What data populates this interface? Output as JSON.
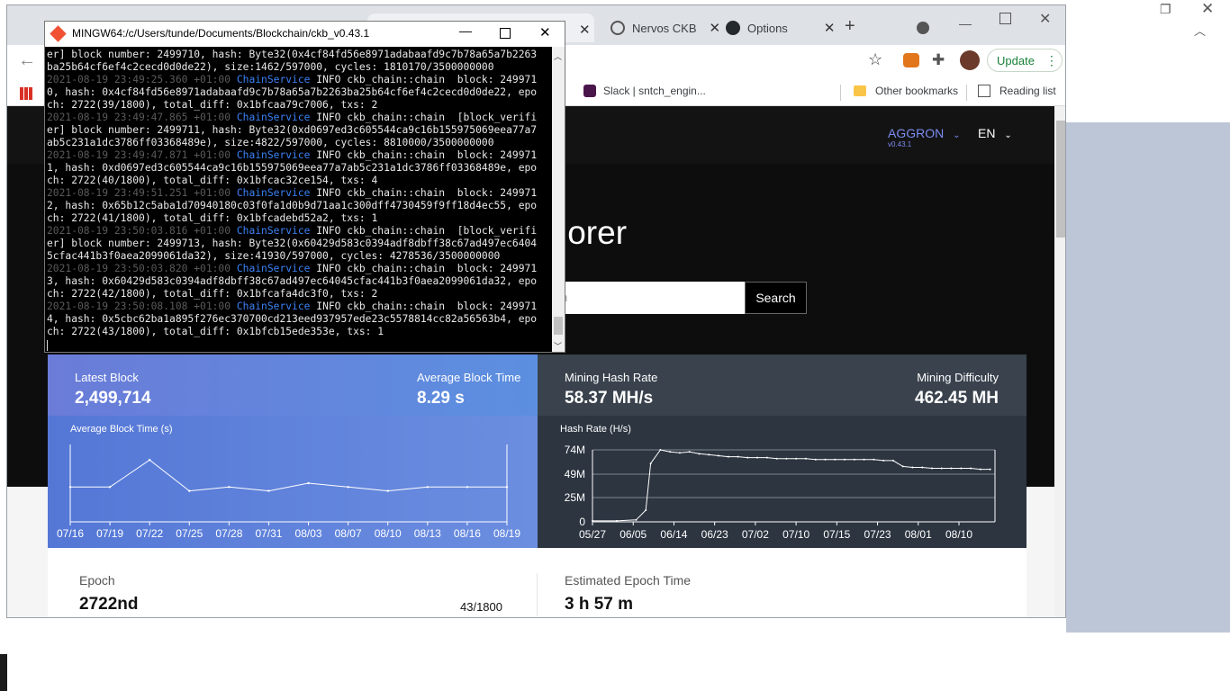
{
  "background_browser": {
    "tabs": [
      {
        "label": "Nervos CKB"
      },
      {
        "label": "Options"
      }
    ],
    "new_tab": "+"
  },
  "browser": {
    "tabs": [
      {
        "label": "Nervos CKB"
      },
      {
        "label": "Options"
      }
    ],
    "new_tab": "+",
    "update_label": "Update",
    "bookmarks": [
      {
        "label": "Slack | sntch_engin..."
      },
      {
        "label": "Other bookmarks"
      },
      {
        "label": "Reading list"
      }
    ]
  },
  "explorer": {
    "network": "AGGRON",
    "version": "v0.43.1",
    "language": "EN",
    "hero_title": "lorer",
    "search_placeholder": "h",
    "search_button": "Search",
    "stats": {
      "latest_block_label": "Latest Block",
      "latest_block": "2,499,714",
      "avg_block_time_label": "Average Block Time",
      "avg_block_time": "8.29 s",
      "hash_rate_label": "Mining Hash Rate",
      "hash_rate": "58.37 MH/s",
      "difficulty_label": "Mining Difficulty",
      "difficulty": "462.45 MH"
    },
    "epoch_label": "Epoch",
    "epoch": "2722nd",
    "epoch_progress": "43/1800",
    "estimated_epoch_label": "Estimated Epoch Time",
    "estimated_epoch": "3 h 57 m"
  },
  "chart_data": [
    {
      "type": "line",
      "title": "Average Block Time (s)",
      "categories": [
        "07/16",
        "07/19",
        "07/22",
        "07/25",
        "07/28",
        "07/31",
        "08/03",
        "08/07",
        "08/10",
        "08/13",
        "08/16",
        "08/19"
      ],
      "series": [
        {
          "values": [
            9,
            9,
            16,
            8,
            9,
            8,
            10,
            9,
            8,
            9,
            9,
            9
          ]
        }
      ],
      "grid": false
    },
    {
      "type": "line",
      "title": "Hash Rate (H/s)",
      "categories": [
        "05/27",
        "06/05",
        "06/14",
        "06/23",
        "07/02",
        "07/10",
        "07/15",
        "07/23",
        "08/01",
        "08/10"
      ],
      "yticks": [
        "0",
        "25M",
        "49M",
        "74M"
      ],
      "ylim": [
        0,
        74
      ],
      "x": [
        0,
        5,
        9,
        11,
        12,
        14,
        16,
        18,
        20,
        22,
        24,
        26,
        28,
        30,
        32,
        34,
        36,
        38,
        40,
        42,
        44,
        46,
        48,
        50,
        52,
        54,
        56,
        58,
        60,
        62,
        64,
        66,
        68,
        70,
        72,
        74,
        76,
        78,
        80,
        82
      ],
      "series": [
        {
          "values": [
            1,
            1,
            2,
            12,
            60,
            74,
            72,
            71,
            72,
            70,
            69,
            68,
            67,
            67,
            66,
            66,
            66,
            65,
            65,
            65,
            65,
            64,
            64,
            64,
            64,
            64,
            64,
            64,
            63,
            63,
            57,
            56,
            56,
            55,
            55,
            55,
            55,
            55,
            54,
            54
          ]
        }
      ],
      "grid": true
    }
  ],
  "terminal": {
    "title": "MINGW64:/c/Users/tunde/Documents/Blockchain/ckb_v0.43.1",
    "lines": [
      {
        "ts": "",
        "svc": "",
        "text": "er] block number: 2499710, hash: Byte32(0x4cf84fd56e8971adabaafd9c7b78a65a7b2263"
      },
      {
        "ts": "",
        "svc": "",
        "text": "ba25b64cf6ef4c2cecd0d0de22), size:1462/597000, cycles: 1810170/3500000000"
      },
      {
        "ts": "2021-08-19 23:49:25.360 +01:00 ",
        "svc": "ChainService",
        "text": " INFO ckb_chain::chain  block: 249971"
      },
      {
        "ts": "",
        "svc": "",
        "text": "0, hash: 0x4cf84fd56e8971adabaafd9c7b78a65a7b2263ba25b64cf6ef4c2cecd0d0de22, epo"
      },
      {
        "ts": "",
        "svc": "",
        "text": "ch: 2722(39/1800), total_diff: 0x1bfcaa79c7006, txs: 2"
      },
      {
        "ts": "2021-08-19 23:49:47.865 +01:00 ",
        "svc": "ChainService",
        "text": " INFO ckb_chain::chain  [block_verifi"
      },
      {
        "ts": "",
        "svc": "",
        "text": "er] block number: 2499711, hash: Byte32(0xd0697ed3c605544ca9c16b155975069eea77a7"
      },
      {
        "ts": "",
        "svc": "",
        "text": "ab5c231a1dc3786ff03368489e), size:4822/597000, cycles: 8810000/3500000000"
      },
      {
        "ts": "2021-08-19 23:49:47.871 +01:00 ",
        "svc": "ChainService",
        "text": " INFO ckb_chain::chain  block: 249971"
      },
      {
        "ts": "",
        "svc": "",
        "text": "1, hash: 0xd0697ed3c605544ca9c16b155975069eea77a7ab5c231a1dc3786ff03368489e, epo"
      },
      {
        "ts": "",
        "svc": "",
        "text": "ch: 2722(40/1800), total_diff: 0x1bfcac32ce154, txs: 4"
      },
      {
        "ts": "2021-08-19 23:49:51.251 +01:00 ",
        "svc": "ChainService",
        "text": " INFO ckb_chain::chain  block: 249971"
      },
      {
        "ts": "",
        "svc": "",
        "text": "2, hash: 0x65b12c5aba1d70940180c03f0fa1d0b9d71aa1c300dff4730459f9ff18d4ec55, epo"
      },
      {
        "ts": "",
        "svc": "",
        "text": "ch: 2722(41/1800), total_diff: 0x1bfcadebd52a2, txs: 1"
      },
      {
        "ts": "2021-08-19 23:50:03.816 +01:00 ",
        "svc": "ChainService",
        "text": " INFO ckb_chain::chain  [block_verifi"
      },
      {
        "ts": "",
        "svc": "",
        "text": "er] block number: 2499713, hash: Byte32(0x60429d583c0394adf8dbff38c67ad497ec6404"
      },
      {
        "ts": "",
        "svc": "",
        "text": "5cfac441b3f0aea2099061da32), size:41930/597000, cycles: 4278536/3500000000"
      },
      {
        "ts": "2021-08-19 23:50:03.820 +01:00 ",
        "svc": "ChainService",
        "text": " INFO ckb_chain::chain  block: 249971"
      },
      {
        "ts": "",
        "svc": "",
        "text": "3, hash: 0x60429d583c0394adf8dbff38c67ad497ec64045cfac441b3f0aea2099061da32, epo"
      },
      {
        "ts": "",
        "svc": "",
        "text": "ch: 2722(42/1800), total_diff: 0x1bfcafa4dc3f0, txs: 2"
      },
      {
        "ts": "2021-08-19 23:50:08.108 +01:00 ",
        "svc": "ChainService",
        "text": " INFO ckb_chain::chain  block: 249971"
      },
      {
        "ts": "",
        "svc": "",
        "text": "4, hash: 0x5cbc62ba1a895f276ec370700cd213eed937957ede23c5578814cc82a56563b4, epo"
      },
      {
        "ts": "",
        "svc": "",
        "text": "ch: 2722(43/1800), total_diff: 0x1bfcb15ede353e, txs: 1"
      }
    ]
  },
  "colors": {
    "accent_blue": "#4f7ad6",
    "explorer_dark": "#0d0d0d",
    "service_blue": "#3b82f6",
    "update_green": "#188038"
  }
}
